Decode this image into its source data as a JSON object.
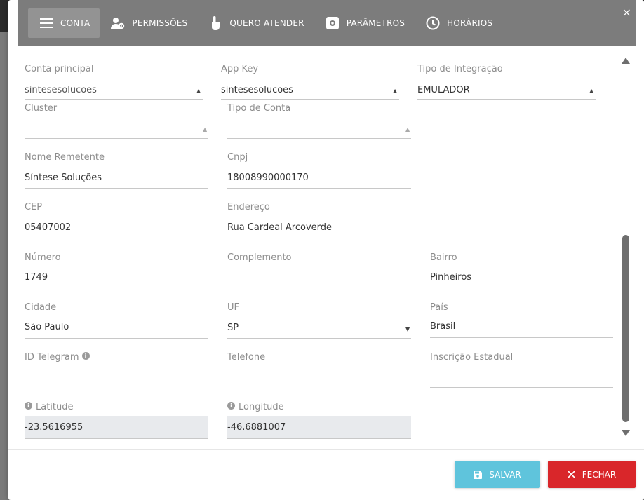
{
  "tabs": [
    {
      "label": "CONTA",
      "icon": "menu-icon",
      "active": true
    },
    {
      "label": "PERMISSÕES",
      "icon": "user-gear-icon",
      "active": false
    },
    {
      "label": "QUERO ATENDER",
      "icon": "hand-pointer-icon",
      "active": false
    },
    {
      "label": "PARÂMETROS",
      "icon": "settings-icon",
      "active": false
    },
    {
      "label": "HORÁRIOS",
      "icon": "clock-icon",
      "active": false
    }
  ],
  "close_glyph": "×",
  "form": {
    "conta_principal": {
      "label": "Conta principal",
      "value": "sintesesolucoes"
    },
    "app_key": {
      "label": "App Key",
      "value": "sintesesolucoes"
    },
    "tipo_integracao": {
      "label": "Tipo de Integração",
      "value": "EMULADOR"
    },
    "cluster": {
      "label": "Cluster",
      "value": ""
    },
    "tipo_conta": {
      "label": "Tipo de Conta",
      "value": ""
    },
    "nome_remetente": {
      "label": "Nome Remetente",
      "value": "Síntese Soluções"
    },
    "cnpj": {
      "label": "Cnpj",
      "value": "18008990000170"
    },
    "cep": {
      "label": "CEP",
      "value": "05407002"
    },
    "endereco": {
      "label": "Endereço",
      "value": "Rua Cardeal Arcoverde"
    },
    "numero": {
      "label": "Número",
      "value": "1749"
    },
    "complemento": {
      "label": "Complemento",
      "value": ""
    },
    "bairro": {
      "label": "Bairro",
      "value": "Pinheiros"
    },
    "cidade": {
      "label": "Cidade",
      "value": "São Paulo"
    },
    "uf": {
      "label": "UF",
      "value": "SP"
    },
    "pais": {
      "label": "País",
      "value": "Brasil"
    },
    "id_telegram": {
      "label": "ID Telegram",
      "value": ""
    },
    "telefone": {
      "label": "Telefone",
      "value": ""
    },
    "inscricao_estadual": {
      "label": "Inscrição Estadual",
      "value": ""
    },
    "latitude": {
      "label": "Latitude",
      "value": "-23.5616955"
    },
    "longitude": {
      "label": "Longitude",
      "value": "-46.6881007"
    }
  },
  "footer": {
    "save_label": "SALVAR",
    "close_label": "FECHAR"
  },
  "colors": {
    "header_bg": "#7c7c7c",
    "save_button": "#5fc4dc",
    "close_button": "#d9262a",
    "readonly_field": "#e8eaed"
  }
}
